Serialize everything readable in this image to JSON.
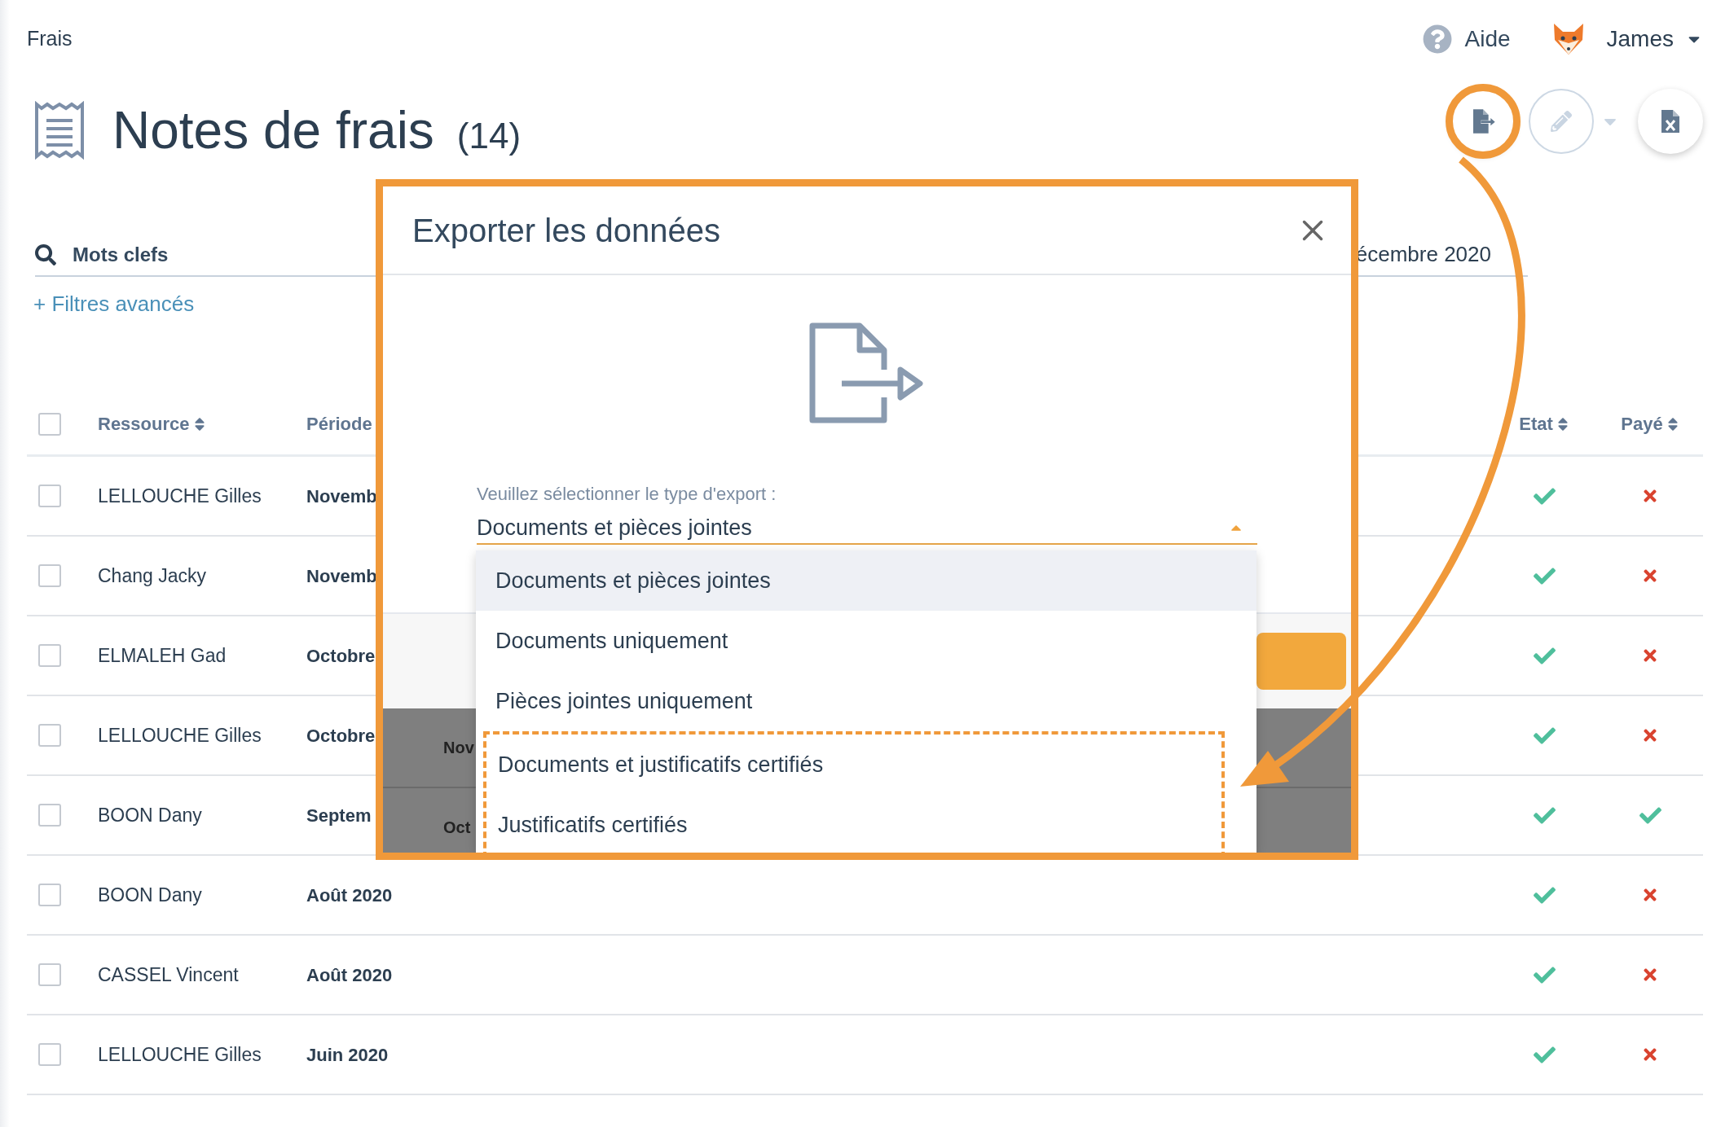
{
  "breadcrumb": "Frais",
  "header": {
    "help": "Aide",
    "user": "James"
  },
  "page": {
    "title": "Notes de frais",
    "count": "(14)"
  },
  "actions": {
    "edit_disabled": true
  },
  "filters": {
    "search_placeholder": "Mots clefs",
    "advanced": "+ Filtres avancés",
    "date": "écembre 2020"
  },
  "table": {
    "select_all": {
      "checked": false
    },
    "columns": [
      {
        "label": "Ressource",
        "sortable": true
      },
      {
        "label": "Période",
        "sortable": false
      },
      {
        "label": "Etat",
        "sortable": true
      },
      {
        "label": "Payé",
        "sortable": true
      }
    ],
    "rows": [
      {
        "resource": "LELLOUCHE Gilles",
        "period": "Novemb",
        "checked": false,
        "approved": true,
        "paid": false
      },
      {
        "resource": "Chang Jacky",
        "period": "Novemb",
        "checked": false,
        "approved": true,
        "paid": false
      },
      {
        "resource": "ELMALEH Gad",
        "period": "Octobre",
        "checked": false,
        "approved": true,
        "paid": false
      },
      {
        "resource": "LELLOUCHE Gilles",
        "period": "Octobre",
        "checked": false,
        "approved": true,
        "paid": false
      },
      {
        "resource": "BOON Dany",
        "period": "Septem",
        "checked": false,
        "approved": true,
        "paid": true
      },
      {
        "resource": "BOON Dany",
        "period": "Août 2020",
        "checked": false,
        "approved": true,
        "paid": false
      },
      {
        "resource": "CASSEL Vincent",
        "period": "Août 2020",
        "checked": false,
        "approved": true,
        "paid": false
      },
      {
        "resource": "LELLOUCHE Gilles",
        "period": "Juin 2020",
        "checked": false,
        "approved": true,
        "paid": false
      }
    ]
  },
  "dialog": {
    "title": "Exporter les données",
    "label": "Veuillez sélectionner le type d'export :",
    "value": "Documents et pièces jointes",
    "options": [
      {
        "label": "Documents et pièces jointes",
        "selected": true,
        "highlighted": false
      },
      {
        "label": "Documents uniquement",
        "selected": false,
        "highlighted": false
      },
      {
        "label": "Pièces jointes uniquement",
        "selected": false,
        "highlighted": false
      },
      {
        "label": "Documents et justificatifs certifiés",
        "selected": false,
        "highlighted": true
      },
      {
        "label": "Justificatifs certifiés",
        "selected": false,
        "highlighted": true
      }
    ],
    "background_rows": [
      "Nov",
      "Oct"
    ]
  }
}
